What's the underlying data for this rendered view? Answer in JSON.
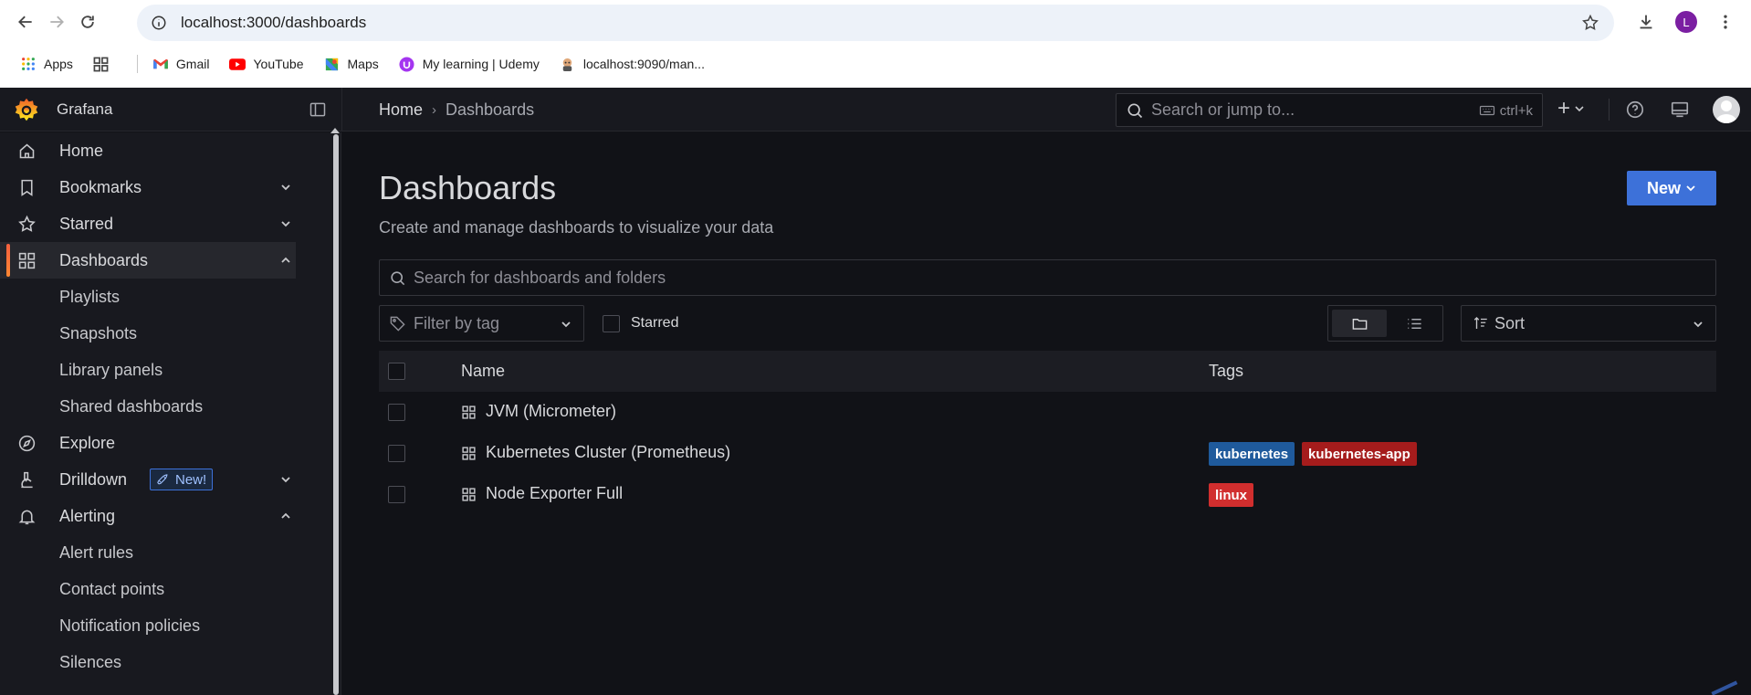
{
  "browser": {
    "url": "localhost:3000/dashboards",
    "profile_initial": "L",
    "bookmarks": [
      {
        "label": "Apps",
        "icon": "apps-grid-icon"
      },
      {
        "label": "",
        "icon": "tab-groups-icon"
      },
      {
        "label": "Gmail",
        "icon": "gmail-icon"
      },
      {
        "label": "YouTube",
        "icon": "youtube-icon"
      },
      {
        "label": "Maps",
        "icon": "maps-icon"
      },
      {
        "label": "My learning | Udemy",
        "icon": "udemy-icon"
      },
      {
        "label": "localhost:9090/man...",
        "icon": "prometheus-icon"
      }
    ]
  },
  "topbar": {
    "brand": "Grafana",
    "breadcrumb": [
      "Home",
      "Dashboards"
    ],
    "search_placeholder": "Search or jump to...",
    "search_shortcut": "ctrl+k"
  },
  "sidebar": {
    "items": [
      {
        "label": "Home",
        "icon": "home-icon"
      },
      {
        "label": "Bookmarks",
        "icon": "bookmark-icon"
      },
      {
        "label": "Starred",
        "icon": "star-icon"
      },
      {
        "label": "Dashboards",
        "icon": "dashboards-icon"
      },
      {
        "label": "Playlists"
      },
      {
        "label": "Snapshots"
      },
      {
        "label": "Library panels"
      },
      {
        "label": "Shared dashboards"
      },
      {
        "label": "Explore",
        "icon": "compass-icon"
      },
      {
        "label": "Drilldown",
        "icon": "microscope-icon",
        "badge": "New!"
      },
      {
        "label": "Alerting",
        "icon": "bell-icon"
      },
      {
        "label": "Alert rules"
      },
      {
        "label": "Contact points"
      },
      {
        "label": "Notification policies"
      },
      {
        "label": "Silences"
      }
    ]
  },
  "page": {
    "title": "Dashboards",
    "subtitle": "Create and manage dashboards to visualize your data",
    "new_button": "New",
    "search_placeholder": "Search for dashboards and folders",
    "filter_tag_placeholder": "Filter by tag",
    "starred_label": "Starred",
    "sort_label": "Sort",
    "columns": {
      "name": "Name",
      "tags": "Tags"
    },
    "rows": [
      {
        "name": "JVM (Micrometer)",
        "tags": []
      },
      {
        "name": "Kubernetes Cluster (Prometheus)",
        "tags": [
          {
            "label": "kubernetes",
            "color": "#1f5a9c"
          },
          {
            "label": "kubernetes-app",
            "color": "#a51c1c"
          }
        ]
      },
      {
        "name": "Node Exporter Full",
        "tags": [
          {
            "label": "linux",
            "color": "#d12e2e"
          }
        ]
      }
    ]
  },
  "colors": {
    "accent": "#3d71d9",
    "active_indicator": "#f55f3e",
    "background": "#111217",
    "panel": "#18191f"
  }
}
